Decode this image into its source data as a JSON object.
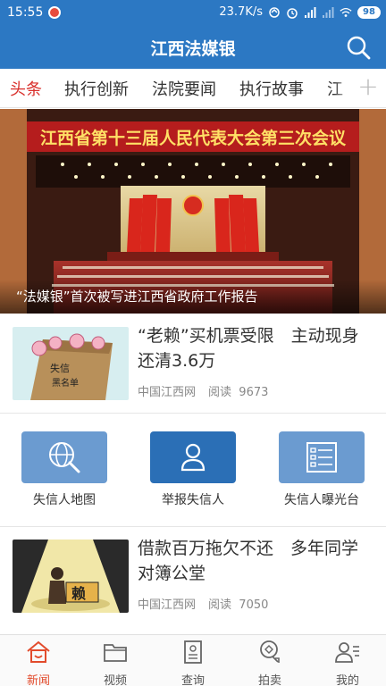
{
  "status_bar": {
    "time": "15:55",
    "network_speed": "23.7K/s",
    "battery": "98"
  },
  "header": {
    "title": "江西法媒银"
  },
  "tabs": [
    {
      "label": "头条",
      "active": true
    },
    {
      "label": "执行创新",
      "active": false
    },
    {
      "label": "法院要闻",
      "active": false
    },
    {
      "label": "执行故事",
      "active": false
    },
    {
      "label": "江",
      "active": false
    }
  ],
  "banner": {
    "hall_banner_text": "江西省第十三届人民代表大会第三次会议",
    "caption": "“法媒银”首次被写进江西省政府工作报告"
  },
  "news": [
    {
      "headline": "“老赖”买机票受限　主动现身还清3.6万",
      "source": "中国江西网",
      "read_label": "阅读",
      "reads": "9673",
      "thumb_text": [
        "失信",
        "黑名单"
      ]
    },
    {
      "headline": "借款百万拖欠不还　多年同学对簿公堂",
      "source": "中国江西网",
      "read_label": "阅读",
      "reads": "7050",
      "thumb_text": [
        "赖"
      ]
    }
  ],
  "actions": [
    {
      "label": "失信人地图",
      "icon": "globe-search-icon"
    },
    {
      "label": "举报失信人",
      "icon": "person-icon"
    },
    {
      "label": "失信人曝光台",
      "icon": "list-icon"
    }
  ],
  "bottom_nav": [
    {
      "label": "新闻",
      "icon": "home-icon",
      "active": true
    },
    {
      "label": "视频",
      "icon": "folder-icon",
      "active": false
    },
    {
      "label": "查询",
      "icon": "document-icon",
      "active": false
    },
    {
      "label": "拍卖",
      "icon": "auction-icon",
      "active": false
    },
    {
      "label": "我的",
      "icon": "profile-icon",
      "active": false
    }
  ],
  "colors": {
    "brand_blue": "#2c78c3",
    "active_tab_red": "#d9302c",
    "active_nav_orange": "#e24b2c"
  }
}
